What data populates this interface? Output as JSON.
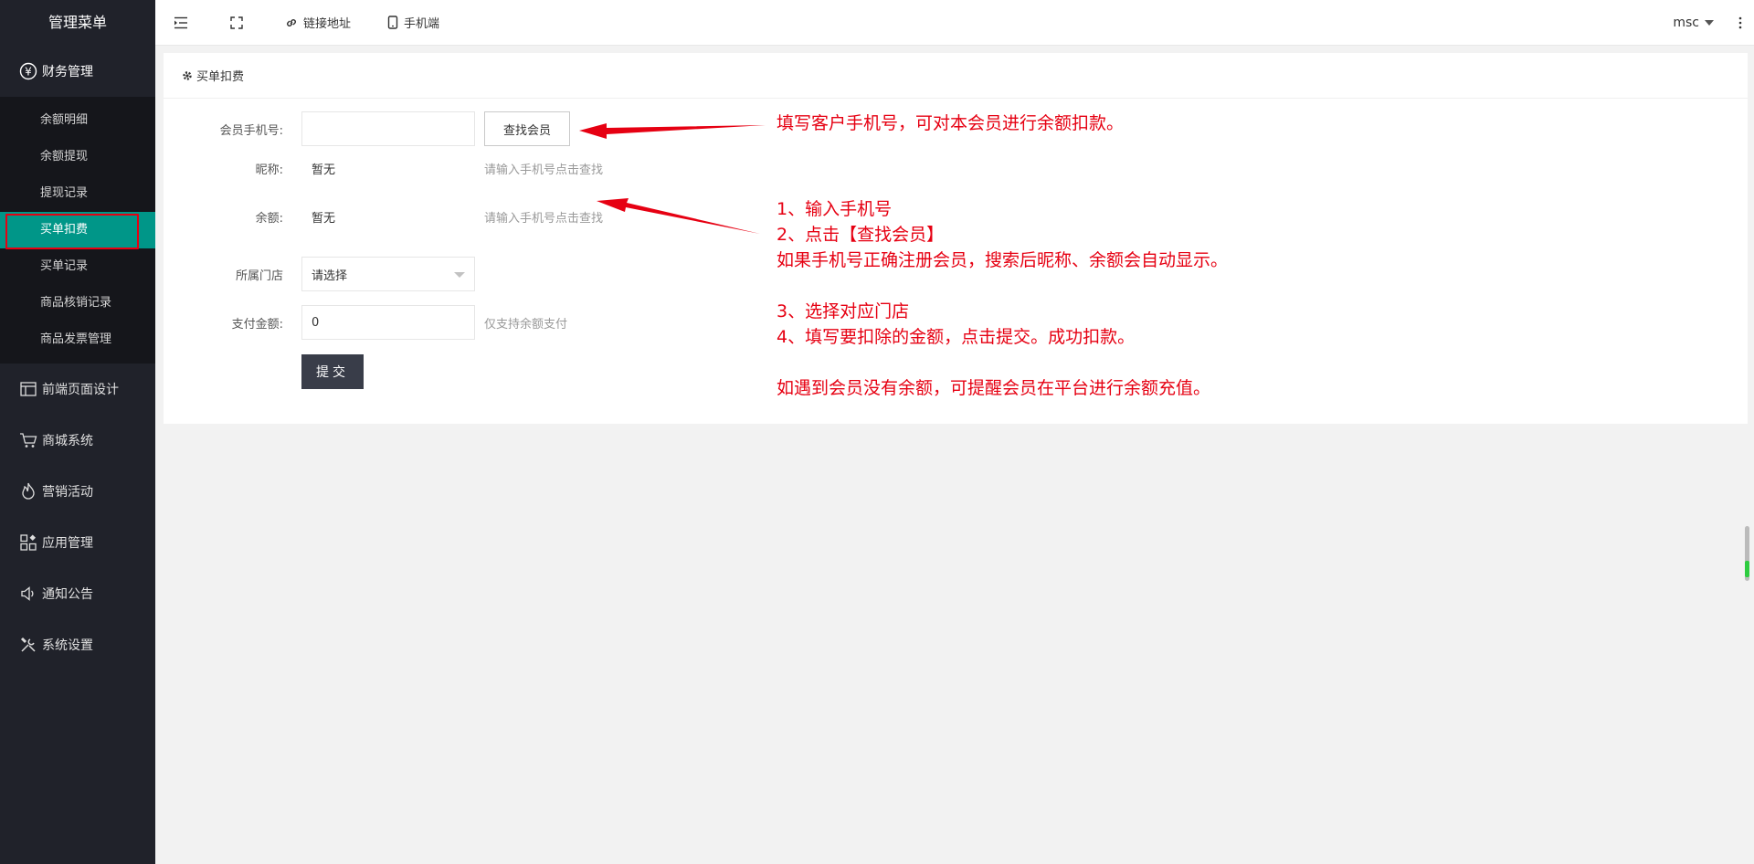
{
  "app": {
    "menu_title": "管理菜单"
  },
  "sidebar": {
    "finance_group": "财务管理",
    "finance_items": [
      "余额明细",
      "余额提现",
      "提现记录",
      "买单扣费",
      "买单记录",
      "商品核销记录",
      "商品发票管理"
    ],
    "items": [
      "前端页面设计",
      "商城系统",
      "营销活动",
      "应用管理",
      "通知公告",
      "系统设置"
    ]
  },
  "header": {
    "link_address": "链接地址",
    "mobile": "手机端",
    "user": "msc"
  },
  "card": {
    "title": "买单扣费",
    "phone_label": "会员手机号:",
    "phone_value": "",
    "find_button": "查找会员",
    "nickname_label": "昵称:",
    "nickname_value": "暂无",
    "nickname_hint": "请输入手机号点击查找",
    "balance_label": "余额:",
    "balance_value": "暂无",
    "balance_hint": "请输入手机号点击查找",
    "store_label": "所属门店",
    "store_value": "请选择",
    "amount_label": "支付金额:",
    "amount_value": "0",
    "amount_hint": "仅支持余额支付",
    "submit_button": "提交"
  },
  "annotations": {
    "note1": "填写客户手机号，可对本会员进行余额扣款。",
    "note2_l1": "1、输入手机号",
    "note2_l2": "2、点击【查找会员】",
    "note2_l3": "如果手机号正确注册会员，搜索后昵称、余额会自动显示。",
    "note2_l4": "3、选择对应门店",
    "note2_l5": "4、填写要扣除的金额，点击提交。成功扣款。",
    "note2_l6": "如遇到会员没有余额，可提醒会员在平台进行余额充值。",
    "color": "#e60012"
  },
  "colors": {
    "sidebar_bg": "#20222a",
    "sidebar_sub_bg": "#15161b",
    "active_bg": "#009688",
    "submit_bg": "#393d49"
  }
}
